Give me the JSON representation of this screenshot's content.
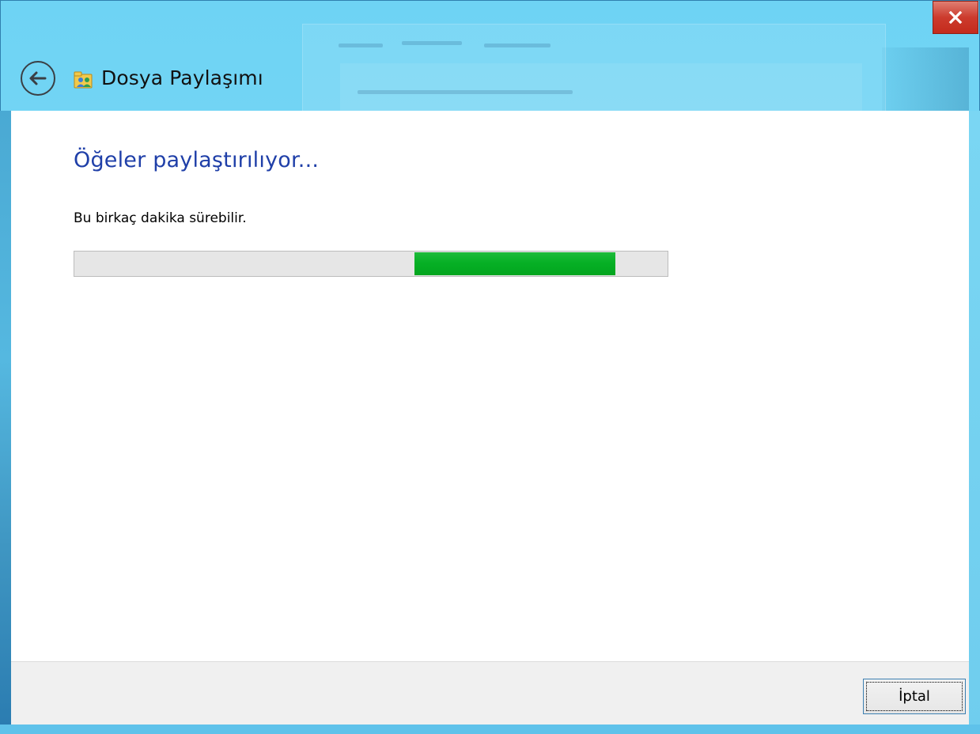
{
  "window": {
    "title": "Dosya Paylaşımı",
    "icons": {
      "back": "back-arrow-icon",
      "app": "file-sharing-icon",
      "close": "close-icon"
    }
  },
  "content": {
    "heading": "Öğeler paylaştırılıyor...",
    "subtext": "Bu birkaç dakika sürebilir.",
    "progress": {
      "state": "marquee",
      "chunk_start_fraction": 0.574,
      "chunk_end_fraction": 0.913
    }
  },
  "footer": {
    "cancel_label": "İptal"
  },
  "colors": {
    "heading": "#1f3fa8",
    "progress_fill": "#06b025",
    "close_button": "#c42b1c",
    "titlebar": "#6ed3f4"
  }
}
